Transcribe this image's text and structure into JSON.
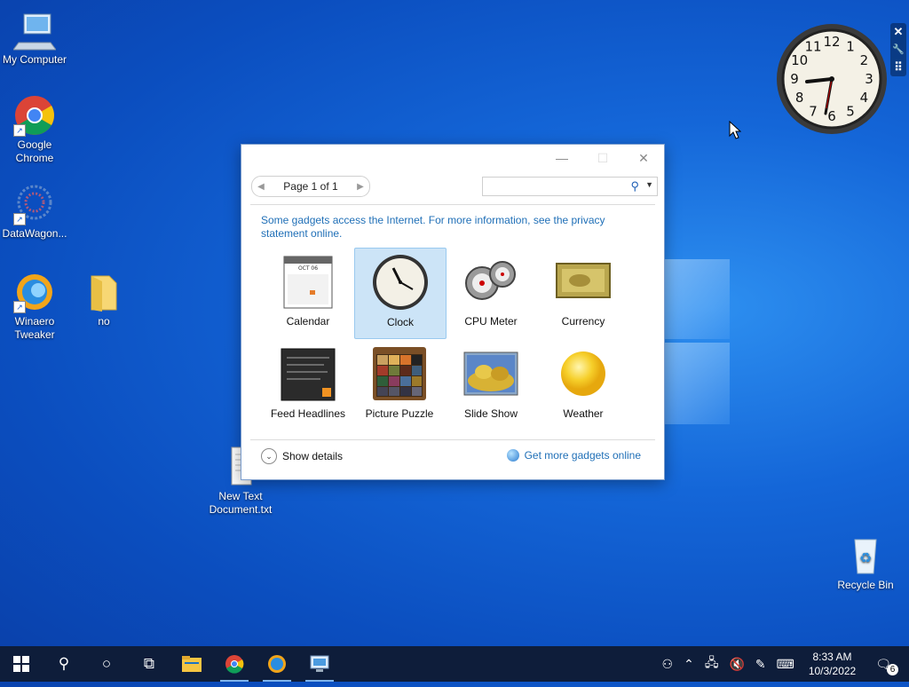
{
  "desktop": {
    "icons": [
      {
        "label": "My Computer"
      },
      {
        "label": "Google Chrome"
      },
      {
        "label": "DataWagon..."
      },
      {
        "label": "Winaero Tweaker"
      },
      {
        "label": "no"
      },
      {
        "label": "New Text Document.txt"
      },
      {
        "label": "Recycle Bin"
      }
    ]
  },
  "clock_gadget": {
    "numbers": [
      "12",
      "1",
      "2",
      "3",
      "4",
      "5",
      "6",
      "7",
      "8",
      "9",
      "10",
      "11"
    ],
    "tools": {
      "close": "✕",
      "settings": "🔧",
      "drag": "⠿"
    }
  },
  "dialog": {
    "pager": {
      "text": "Page 1 of 1",
      "prev": "◀",
      "next": "▶"
    },
    "search": {
      "placeholder": "",
      "icon": "search-icon",
      "dropdown": "▼"
    },
    "info_text": "Some gadgets access the Internet.  For more information, see the privacy statement online.",
    "gadgets": [
      {
        "label": "Calendar",
        "selected": false
      },
      {
        "label": "Clock",
        "selected": true
      },
      {
        "label": "CPU Meter",
        "selected": false
      },
      {
        "label": "Currency",
        "selected": false
      },
      {
        "label": "Feed Headlines",
        "selected": false
      },
      {
        "label": "Picture Puzzle",
        "selected": false
      },
      {
        "label": "Slide Show",
        "selected": false
      },
      {
        "label": "Weather",
        "selected": false
      }
    ],
    "calendar_month": "OCT 06",
    "show_details": "Show details",
    "get_more": "Get more gadgets online"
  },
  "taskbar": {
    "time": "8:33 AM",
    "date": "10/3/2022",
    "notifications": "6"
  },
  "colors": {
    "accent": "#1f6fb7",
    "taskbar": "#0e1d3a",
    "selection": "#cce4f7"
  }
}
